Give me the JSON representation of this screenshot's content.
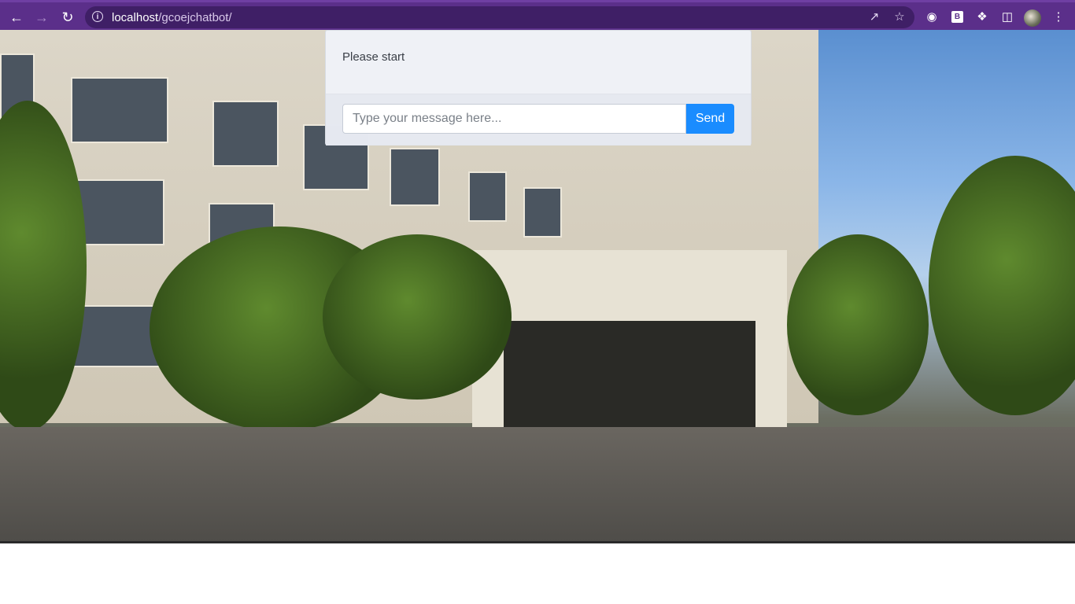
{
  "browser": {
    "url_host": "localhost",
    "url_path": "/gcoejchatbot/",
    "back_icon": "arrow-left-icon",
    "forward_icon": "arrow-right-icon",
    "reload_icon": "reload-icon",
    "info_icon": "i",
    "extension_b_label": "B",
    "accent_color": "#5b2f8a"
  },
  "chat": {
    "message": "Please start",
    "input_placeholder": "Type your message here...",
    "send_label": "Send",
    "send_color": "#1a8cff"
  }
}
